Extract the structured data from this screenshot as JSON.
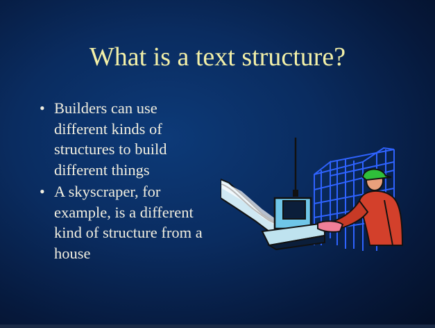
{
  "slide": {
    "title": "What is a text structure?",
    "bullets": [
      {
        "text": "Builders can use different kinds of structures to build different things"
      },
      {
        "text": "A skyscraper, for example, is a different kind of structure from a house"
      }
    ],
    "clipart": {
      "icon": "construction-worker-icon"
    },
    "colors": {
      "title": "#f3f0a8",
      "body": "#f2efe0",
      "background": "#0a2c60"
    }
  }
}
